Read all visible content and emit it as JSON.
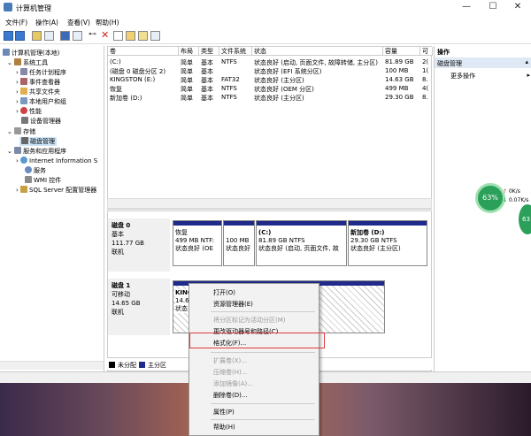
{
  "window": {
    "title": "计算机管理",
    "minimize": "—",
    "maximize": "☐",
    "close": "✕"
  },
  "menu": [
    "文件(F)",
    "操作(A)",
    "查看(V)",
    "帮助(H)"
  ],
  "tree": {
    "root": "计算机管理(本地)",
    "items": [
      "系统工具",
      "任务计划程序",
      "事件查看器",
      "共享文件夹",
      "本地用户和组",
      "性能",
      "设备管理器",
      "存储",
      "磁盘管理",
      "服务和应用程序",
      "Internet Information S",
      "服务",
      "WMI 控件",
      "SQL Server 配置管理器"
    ]
  },
  "volumes": {
    "headers": [
      "卷",
      "布局",
      "类型",
      "文件系统",
      "状态",
      "容量",
      "可"
    ],
    "rows": [
      [
        "(C:)",
        "简单",
        "基本",
        "NTFS",
        "状态良好 (启动, 页面文件, 故障转储, 主分区)",
        "81.89 GB",
        "2("
      ],
      [
        "(磁盘 0 磁盘分区 2)",
        "简单",
        "基本",
        "",
        "状态良好 (EFI 系统分区)",
        "100 MB",
        "1("
      ],
      [
        "KINGSTON (E:)",
        "简单",
        "基本",
        "FAT32",
        "状态良好 (主分区)",
        "14.63 GB",
        "8."
      ],
      [
        "恢复",
        "简单",
        "基本",
        "NTFS",
        "状态良好 (OEM 分区)",
        "499 MB",
        "4("
      ],
      [
        "新加卷 (D:)",
        "简单",
        "基本",
        "NTFS",
        "状态良好 (主分区)",
        "29.30 GB",
        "8."
      ]
    ]
  },
  "disk0": {
    "name": "磁盘 0",
    "type": "基本",
    "size": "111.77 GB",
    "status": "联机",
    "parts": [
      {
        "title": "恢复",
        "l1": "499 MB NTF:",
        "l2": "状态良好 (OE"
      },
      {
        "title": "",
        "l1": "100 MB",
        "l2": "状态良好"
      },
      {
        "title": "(C:)",
        "l1": "81.89 GB NTFS",
        "l2": "状态良好 (启动, 页面文件, 故"
      },
      {
        "title": "新加卷 (D:)",
        "l1": "29.30 GB NTFS",
        "l2": "状态良好 (主分区)"
      }
    ]
  },
  "disk1": {
    "name": "磁盘 1",
    "type": "可移动",
    "size": "14.65 GB",
    "status": "联机",
    "part": {
      "title": "KINGS",
      "l1": "14.65",
      "l2": "状态良"
    }
  },
  "legend": {
    "unalloc": "未分配",
    "primary": "主分区"
  },
  "actions": {
    "title": "操作",
    "section": "磁盘管理",
    "more": "更多操作"
  },
  "context_menu": [
    {
      "label": "打开(O)",
      "disabled": false
    },
    {
      "label": "资源管理器(E)",
      "disabled": false
    },
    {
      "label": "将分区标记为活动分区(M)",
      "disabled": true
    },
    {
      "label": "更改驱动器号和路径(C)...",
      "disabled": false
    },
    {
      "label": "格式化(F)...",
      "disabled": false
    },
    {
      "label": "扩展卷(X)...",
      "disabled": true
    },
    {
      "label": "压缩卷(H)...",
      "disabled": true
    },
    {
      "label": "添加镜像(A)...",
      "disabled": true
    },
    {
      "label": "删除卷(D)...",
      "disabled": false
    },
    {
      "label": "属性(P)",
      "disabled": false
    },
    {
      "label": "帮助(H)",
      "disabled": false
    }
  ],
  "gauge": {
    "percent": "63%",
    "up": "0K/s",
    "down": "0.07K/s",
    "percent2": "63"
  },
  "colors": {
    "primary_partition": "#1f2a8a",
    "unallocated": "#000000",
    "highlight": "#e03a3a",
    "gauge": "#2aa05a"
  }
}
